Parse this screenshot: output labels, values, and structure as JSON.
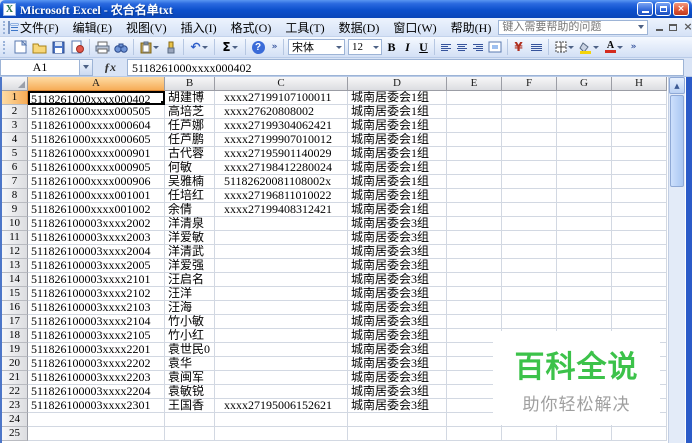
{
  "window": {
    "title": "Microsoft Excel - 农合名单txt",
    "app_icon_letter": "X",
    "buttons": [
      "minimize",
      "restore",
      "close"
    ],
    "close_glyph": "×"
  },
  "menu": {
    "items": [
      "文件(F)",
      "编辑(E)",
      "视图(V)",
      "插入(I)",
      "格式(O)",
      "工具(T)",
      "数据(D)",
      "窗口(W)",
      "帮助(H)"
    ],
    "help_placeholder": "键入需要帮助的问题",
    "workbook_close_glyph": "×"
  },
  "toolbar": {
    "standard_icons": [
      "new",
      "open",
      "save",
      "permission",
      "print",
      "find",
      "paste-options",
      "format-painter",
      "undo",
      "autosum",
      "help",
      "toolbar-options"
    ],
    "format_icons": [
      "bold",
      "italic",
      "underline",
      "align-left",
      "align-center",
      "align-right",
      "merge-center",
      "currency",
      "increase-indent",
      "borders",
      "fill-color",
      "font-color",
      "toolbar-options"
    ],
    "font_name": "宋体",
    "font_size": "12",
    "bold_label": "B",
    "italic_label": "I",
    "underline_label": "U",
    "autosum_glyph": "Σ",
    "undo_glyph": "↶",
    "currency_glyph": "¥",
    "help_glyph": "?",
    "font_color_glyph": "A",
    "overflow_glyph": "»"
  },
  "formula_bar": {
    "name_box": "A1",
    "fx_label": "ƒx",
    "value": "5118261000xxxx000402"
  },
  "sheet": {
    "selected_cell": "A1",
    "columns": [
      "A",
      "B",
      "C",
      "D",
      "E",
      "F",
      "G",
      "H"
    ],
    "rows": [
      [
        "5118261000xxxx000402",
        "胡建博",
        "xxxx27199107100011",
        "城南居委会1组"
      ],
      [
        "5118261000xxxx000505",
        "高培芝",
        "xxxx27620808002",
        "城南居委会1组"
      ],
      [
        "5118261000xxxx000604",
        "任芦娜",
        "xxxx27199304062421",
        "城南居委会1组"
      ],
      [
        "5118261000xxxx000605",
        "任芦鹏",
        "xxxx27199907010012",
        "城南居委会1组"
      ],
      [
        "5118261000xxxx000901",
        "古代蓉",
        "xxxx27195901140029",
        "城南居委会1组"
      ],
      [
        "5118261000xxxx000905",
        "何敏",
        "xxxx27198412280024",
        "城南居委会1组"
      ],
      [
        "5118261000xxxx000906",
        "吴雅楠",
        "51182620081108002x",
        "城南居委会1组"
      ],
      [
        "5118261000xxxx001001",
        "任培红",
        "xxxx27196811010022",
        "城南居委会1组"
      ],
      [
        "5118261000xxxx001002",
        "余倩",
        "xxxx27199408312421",
        "城南居委会1组"
      ],
      [
        "511826100003xxxx2002",
        "洋清泉",
        "",
        "城南居委会3组"
      ],
      [
        "511826100003xxxx2003",
        "洋爱敏",
        "",
        "城南居委会3组"
      ],
      [
        "511826100003xxxx2004",
        "洋清武",
        "",
        "城南居委会3组"
      ],
      [
        "511826100003xxxx2005",
        "洋爱强",
        "",
        "城南居委会3组"
      ],
      [
        "511826100003xxxx2101",
        "汪启名",
        "",
        "城南居委会3组"
      ],
      [
        "511826100003xxxx2102",
        "汪洋",
        "",
        "城南居委会3组"
      ],
      [
        "511826100003xxxx2103",
        "汪海",
        "",
        "城南居委会3组"
      ],
      [
        "511826100003xxxx2104",
        "竹小敏",
        "",
        "城南居委会3组"
      ],
      [
        "511826100003xxxx2105",
        "竹小红",
        "",
        "城南居委会3组"
      ],
      [
        "511826100003xxxx2201",
        "袁世民0",
        "",
        "城南居委会3组"
      ],
      [
        "511826100003xxxx2202",
        "袁华",
        "",
        "城南居委会3组"
      ],
      [
        "511826100003xxxx2203",
        "袁闽军",
        "",
        "城南居委会3组"
      ],
      [
        "511826100003xxxx2204",
        "袁敏锐",
        "",
        "城南居委会3组"
      ],
      [
        "511826100003xxxx2301",
        "王国香",
        "xxxx27195006152621",
        "城南居委会3组"
      ],
      [
        "",
        "",
        "",
        ""
      ],
      [
        "",
        "",
        "",
        ""
      ]
    ]
  },
  "watermark": {
    "title": "百科全说",
    "subtitle": "助你轻松解决",
    "title_color": "#3cc24a",
    "subtitle_color": "#9f9f9f"
  }
}
